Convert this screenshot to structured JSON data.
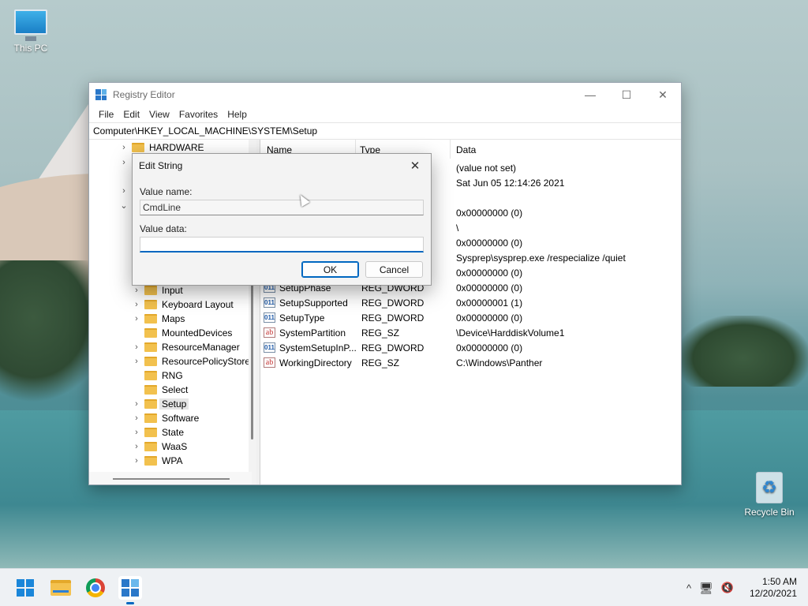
{
  "desktop": {
    "icons": [
      {
        "label": "This PC"
      },
      {
        "label": "Recycle Bin"
      }
    ]
  },
  "window": {
    "title": "Registry Editor",
    "controls": {
      "minimize": "—",
      "maximize": "☐",
      "close": "✕"
    },
    "menu": [
      "File",
      "Edit",
      "View",
      "Favorites",
      "Help"
    ],
    "address": "Computer\\HKEY_LOCAL_MACHINE\\SYSTEM\\Setup",
    "tree": [
      {
        "label": "HARDWARE",
        "chevron": "›",
        "level": 1
      },
      {
        "label": "Input",
        "chevron": "›",
        "level": 2
      },
      {
        "label": "Keyboard Layout",
        "chevron": "›",
        "level": 2
      },
      {
        "label": "Maps",
        "chevron": "›",
        "level": 2
      },
      {
        "label": "MountedDevices",
        "chevron": "",
        "level": 2
      },
      {
        "label": "ResourceManager",
        "chevron": "›",
        "level": 2
      },
      {
        "label": "ResourcePolicyStore",
        "chevron": "›",
        "level": 2
      },
      {
        "label": "RNG",
        "chevron": "",
        "level": 2
      },
      {
        "label": "Select",
        "chevron": "",
        "level": 2
      },
      {
        "label": "Setup",
        "chevron": "›",
        "level": 2,
        "selected": true
      },
      {
        "label": "Software",
        "chevron": "›",
        "level": 2
      },
      {
        "label": "State",
        "chevron": "›",
        "level": 2
      },
      {
        "label": "WaaS",
        "chevron": "›",
        "level": 2
      },
      {
        "label": "WPA",
        "chevron": "›",
        "level": 2
      }
    ],
    "columns": {
      "name": "Name",
      "type": "Type",
      "data": "Data"
    },
    "values": [
      {
        "name": "",
        "type": "",
        "data": "(value not set)",
        "icon": ""
      },
      {
        "name": "",
        "type": "",
        "data": "Sat Jun 05 12:14:26 2021",
        "icon": ""
      },
      {
        "name": "",
        "type": "",
        "data": "0x00000000 (0)",
        "icon": ""
      },
      {
        "name": "",
        "type": "",
        "data": "\\",
        "icon": ""
      },
      {
        "name": "",
        "type": "",
        "data": "0x00000000 (0)",
        "icon": ""
      },
      {
        "name": "",
        "type": "",
        "data": "Sysprep\\sysprep.exe /respecialize /quiet",
        "icon": ""
      },
      {
        "name": "",
        "type": "",
        "data": "0x00000000 (0)",
        "icon": ""
      },
      {
        "name": "SetupPhase",
        "type": "REG_DWORD",
        "data": "0x00000000 (0)",
        "icon": "dword"
      },
      {
        "name": "SetupSupported",
        "type": "REG_DWORD",
        "data": "0x00000001 (1)",
        "icon": "dword"
      },
      {
        "name": "SetupType",
        "type": "REG_DWORD",
        "data": "0x00000000 (0)",
        "icon": "dword"
      },
      {
        "name": "SystemPartition",
        "type": "REG_SZ",
        "data": "\\Device\\HarddiskVolume1",
        "icon": "sz"
      },
      {
        "name": "SystemSetupInP...",
        "type": "REG_DWORD",
        "data": "0x00000000 (0)",
        "icon": "dword"
      },
      {
        "name": "WorkingDirectory",
        "type": "REG_SZ",
        "data": "C:\\Windows\\Panther",
        "icon": "sz"
      }
    ],
    "icon_glyphs": {
      "dword": "011",
      "sz": "ab"
    }
  },
  "dialog": {
    "title": "Edit String",
    "close": "✕",
    "value_name_label": "Value name:",
    "value_name": "CmdLine",
    "value_data_label": "Value data:",
    "value_data": "",
    "ok": "OK",
    "cancel": "Cancel"
  },
  "taskbar": {
    "apps": [
      "start-icon",
      "file-explorer-icon",
      "chrome-icon",
      "registry-editor-icon"
    ],
    "tray": {
      "chevron": "^"
    },
    "time": "1:50 AM",
    "date": "12/20/2021"
  }
}
